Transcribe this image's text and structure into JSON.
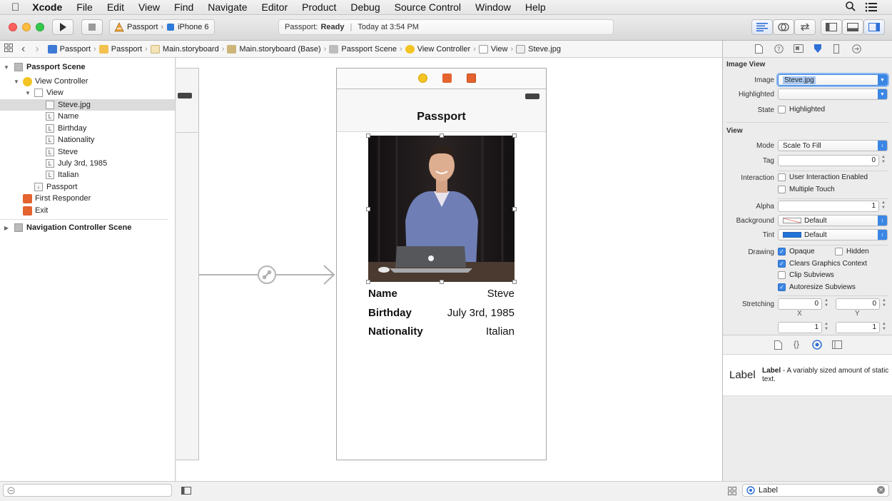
{
  "menubar": {
    "items": [
      "Xcode",
      "File",
      "Edit",
      "View",
      "Find",
      "Navigate",
      "Editor",
      "Product",
      "Debug",
      "Source Control",
      "Window",
      "Help"
    ]
  },
  "toolbar": {
    "scheme_project": "Passport",
    "scheme_device": "iPhone 6",
    "status_project": "Passport:",
    "status_state": "Ready",
    "status_time": "Today at 3:54 PM"
  },
  "jumpbar": {
    "crumbs": [
      "Passport",
      "Passport",
      "Main.storyboard",
      "Main.storyboard (Base)",
      "Passport Scene",
      "View Controller",
      "View",
      "Steve.jpg"
    ]
  },
  "outline": {
    "rows": [
      {
        "label": "Passport Scene"
      },
      {
        "label": "View Controller"
      },
      {
        "label": "View"
      },
      {
        "label": "Steve.jpg"
      },
      {
        "label": "Name"
      },
      {
        "label": "Birthday"
      },
      {
        "label": "Nationality"
      },
      {
        "label": "Steve"
      },
      {
        "label": "July 3rd, 1985"
      },
      {
        "label": "Italian"
      },
      {
        "label": "Passport"
      },
      {
        "label": "First Responder"
      },
      {
        "label": "Exit"
      },
      {
        "label": "Navigation Controller Scene"
      }
    ]
  },
  "canvas": {
    "nav_title": "Passport",
    "rows": [
      {
        "key": "Name",
        "value": "Steve"
      },
      {
        "key": "Birthday",
        "value": "July 3rd, 1985"
      },
      {
        "key": "Nationality",
        "value": "Italian"
      }
    ]
  },
  "inspector": {
    "image_view_title": "Image View",
    "image_label": "Image",
    "image_value": "Steve.jpg",
    "highlighted_label": "Highlighted",
    "state_label": "State",
    "state_checkbox": "Highlighted",
    "view_title": "View",
    "mode_label": "Mode",
    "mode_value": "Scale To Fill",
    "tag_label": "Tag",
    "tag_value": "0",
    "interaction_label": "Interaction",
    "user_interaction": "User Interaction Enabled",
    "multiple_touch": "Multiple Touch",
    "alpha_label": "Alpha",
    "alpha_value": "1",
    "background_label": "Background",
    "background_value": "Default",
    "tint_label": "Tint",
    "tint_value": "Default",
    "drawing_label": "Drawing",
    "opaque": "Opaque",
    "hidden": "Hidden",
    "clears": "Clears Graphics Context",
    "clip": "Clip Subviews",
    "autoresize": "Autoresize Subviews",
    "stretching_label": "Stretching",
    "stretch_x": "0",
    "stretch_y": "0",
    "stretch_w": "1",
    "stretch_h": "1",
    "x_caption": "X",
    "y_caption": "Y",
    "library_big": "Label",
    "library_name": "Label",
    "library_desc": "- A variably sized amount of static text.",
    "filter_value": "Label"
  },
  "colors": {
    "accent": "#3b86e4",
    "scene_icon_yellow": "#f3c321",
    "scene_icon_orange": "#e4632f"
  }
}
